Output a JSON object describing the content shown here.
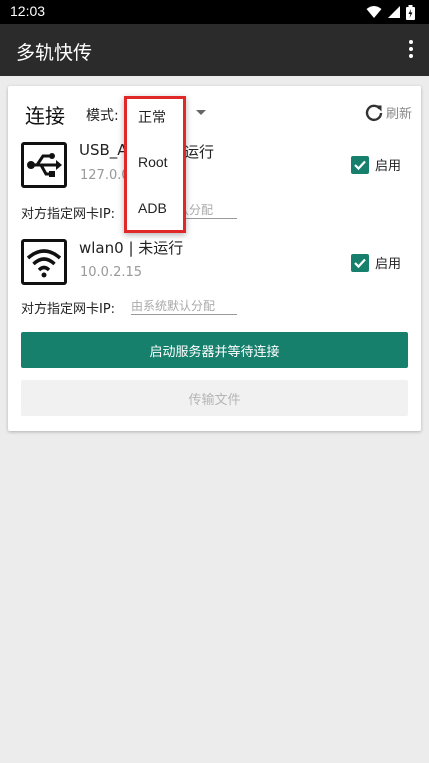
{
  "status_bar": {
    "time": "12:03"
  },
  "app_bar": {
    "title": "多轨快传",
    "menu_icon": "more-vert-icon"
  },
  "connect": {
    "title": "连接",
    "mode_label": "模式:",
    "refresh_label": "刷新",
    "devices": [
      {
        "icon": "usb-icon",
        "name": "USB_AC",
        "status_tail": "运行",
        "ip": "127.0.0.1",
        "enabled": true,
        "enable_label": "启用",
        "peer_ip_label": "对方指定网卡IP:",
        "peer_ip_placeholder": "认分配"
      },
      {
        "icon": "wifi-icon",
        "name": "wlan0 | 未运行",
        "ip": "10.0.2.15",
        "enabled": true,
        "enable_label": "启用",
        "peer_ip_label": "对方指定网卡IP:",
        "peer_ip_placeholder": "由系统默认分配"
      }
    ],
    "start_button": "启动服务器并等待连接",
    "transfer_button": "传输文件"
  },
  "mode_dropdown": {
    "options": [
      "正常",
      "Root",
      "ADB"
    ]
  },
  "colors": {
    "accent": "#17806d",
    "highlight_border": "#e02828",
    "app_bar": "#2b2b2b"
  }
}
